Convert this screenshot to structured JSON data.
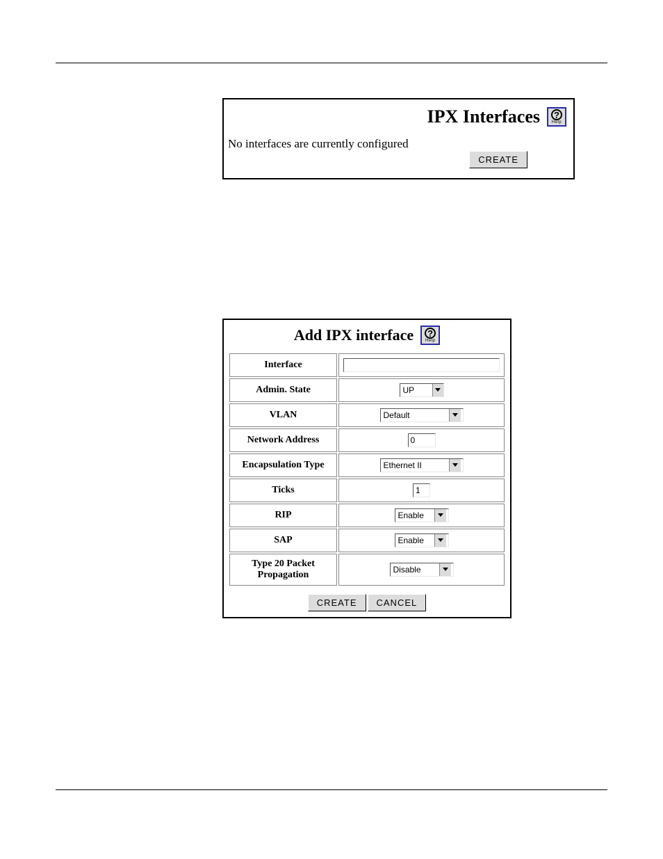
{
  "panel1": {
    "title": "IPX Interfaces",
    "help_label": "Help",
    "message": "No interfaces are currently configured",
    "create_button": "CREATE"
  },
  "panel2": {
    "title": "Add IPX interface",
    "help_label": "Help",
    "rows": {
      "interface": {
        "label": "Interface",
        "value": ""
      },
      "admin_state": {
        "label": "Admin. State",
        "value": "UP"
      },
      "vlan": {
        "label": "VLAN",
        "value": "Default"
      },
      "network_addr": {
        "label": "Network Address",
        "value": "0"
      },
      "encapsulation": {
        "label": "Encapsulation Type",
        "value": "Ethernet II"
      },
      "ticks": {
        "label": "Ticks",
        "value": "1"
      },
      "rip": {
        "label": "RIP",
        "value": "Enable"
      },
      "sap": {
        "label": "SAP",
        "value": "Enable"
      },
      "type20": {
        "label": "Type 20 Packet Propagation",
        "value": "Disable"
      }
    },
    "buttons": {
      "create": "CREATE",
      "cancel": "CANCEL"
    }
  }
}
